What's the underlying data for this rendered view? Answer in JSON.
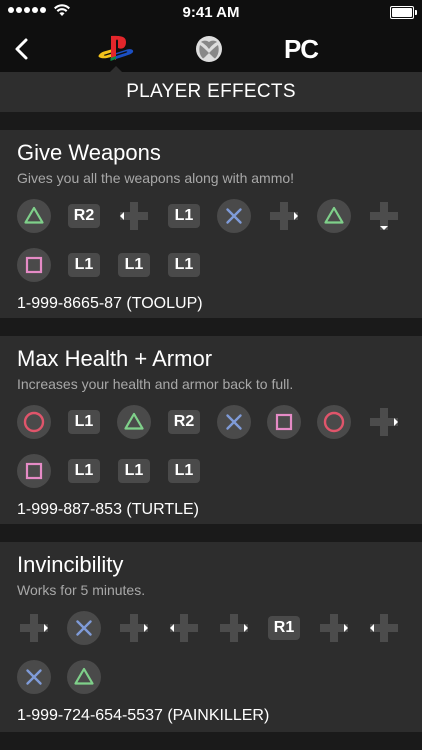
{
  "status_bar": {
    "time": "9:41 AM"
  },
  "nav": {
    "platforms": {
      "pc": "PC"
    }
  },
  "section": {
    "title": "PLAYER EFFECTS"
  },
  "cheats": [
    {
      "title": "Give Weapons",
      "description": "Gives you all the weapons along with ammo!",
      "code": "1-999-8665-87 (TOOLUP)",
      "rows": [
        [
          "triangle",
          "R2",
          "dpad-left",
          "L1",
          "cross",
          "dpad-right",
          "triangle",
          "dpad-down"
        ],
        [
          "square",
          "L1",
          "L1",
          "L1"
        ]
      ]
    },
    {
      "title": "Max Health + Armor",
      "description": "Increases your health and armor back to full.",
      "code": "1-999-887-853 (TURTLE)",
      "rows": [
        [
          "circle",
          "L1",
          "triangle",
          "R2",
          "cross",
          "square",
          "circle",
          "dpad-right"
        ],
        [
          "square",
          "L1",
          "L1",
          "L1"
        ]
      ]
    },
    {
      "title": "Invincibility",
      "description": "Works for 5 minutes.",
      "code": "1-999-724-654-5537 (PAINKILLER)",
      "rows": [
        [
          "dpad-right",
          "cross",
          "dpad-right",
          "dpad-left",
          "dpad-right",
          "R1",
          "dpad-right",
          "dpad-left"
        ],
        [
          "cross",
          "triangle"
        ]
      ]
    }
  ],
  "colors": {
    "triangle": "#7fd08a",
    "cross": "#7f9bd8",
    "circle": "#e0556b",
    "square": "#e58bc6"
  }
}
